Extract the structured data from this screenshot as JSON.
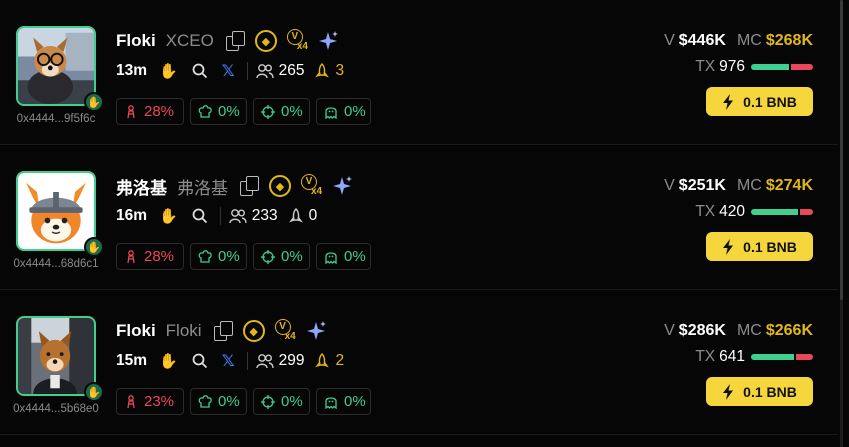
{
  "tokens": [
    {
      "name": "Floki",
      "ticker": "XCEO",
      "address": "0x4444...9f5f6c",
      "age": "13m",
      "show_x": true,
      "holders": "265",
      "rocket_count": "3",
      "rocket_color": "gold",
      "stats": {
        "top10": "28%",
        "chef": "0%",
        "sniper": "0%",
        "ghost": "0%"
      },
      "volume_label": "V",
      "volume": "$446K",
      "mc_label": "MC",
      "mc": "$268K",
      "tx_label": "TX",
      "tx": "976",
      "buy_ratio": 0.62,
      "buy_label": "0.1 BNB",
      "avatar_icon": "dog-with-glasses-avatar"
    },
    {
      "name": "弗洛基",
      "ticker": "弗洛基",
      "address": "0x4444...68d6c1",
      "age": "16m",
      "show_x": false,
      "holders": "233",
      "rocket_count": "0",
      "rocket_color": "white",
      "stats": {
        "top10": "28%",
        "chef": "0%",
        "sniper": "0%",
        "ghost": "0%"
      },
      "volume_label": "V",
      "volume": "$251K",
      "mc_label": "MC",
      "mc": "$274K",
      "tx_label": "TX",
      "tx": "420",
      "buy_ratio": 0.75,
      "buy_label": "0.1 BNB",
      "avatar_icon": "shiba-viking-avatar"
    },
    {
      "name": "Floki",
      "ticker": "Floki",
      "address": "0x4444...5b68e0",
      "age": "15m",
      "show_x": true,
      "holders": "299",
      "rocket_count": "2",
      "rocket_color": "gold",
      "stats": {
        "top10": "23%",
        "chef": "0%",
        "sniper": "0%",
        "ghost": "0%"
      },
      "volume_label": "V",
      "volume": "$286K",
      "mc_label": "MC",
      "mc": "$266K",
      "tx_label": "TX",
      "tx": "641",
      "buy_ratio": 0.7,
      "buy_label": "0.1 BNB",
      "avatar_icon": "shiba-in-car-avatar"
    }
  ],
  "colors": {
    "accent_yellow": "#f5d63c",
    "gold": "#e2b818",
    "green": "#3fcf8e",
    "red": "#e8485a",
    "muted": "#8c8c8c"
  }
}
